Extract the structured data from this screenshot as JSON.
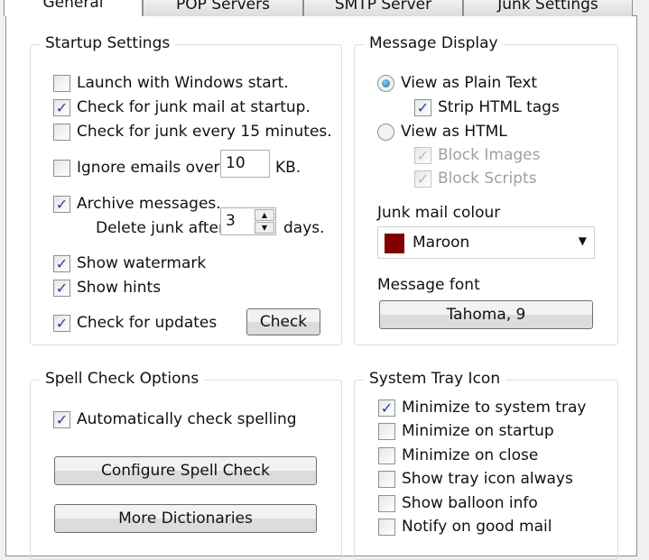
{
  "tabs": [
    "General",
    "POP Servers",
    "SMTP Server",
    "Junk Settings"
  ],
  "startup": {
    "title": "Startup Settings",
    "launch": "Launch with Windows start.",
    "check_startup": "Check for junk mail at startup.",
    "check_every": "Check for junk every 15 minutes.",
    "ignore": "Ignore emails over",
    "ignore_value": "10",
    "ignore_unit": "KB.",
    "archive": "Archive messages.",
    "delete_after": "Delete junk after",
    "delete_value": "3",
    "delete_unit": "days.",
    "watermark": "Show watermark",
    "hints": "Show hints",
    "updates": "Check for updates",
    "check_button": "Check"
  },
  "display": {
    "title": "Message Display",
    "plain": "View as Plain Text",
    "strip": "Strip HTML tags",
    "html": "View as HTML",
    "block_images": "Block Images",
    "block_scripts": "Block Scripts",
    "colour_label": "Junk mail colour",
    "colour_value": "Maroon",
    "colour_hex": "#800000",
    "font_label": "Message font",
    "font_button": "Tahoma, 9"
  },
  "spell": {
    "title": "Spell Check Options",
    "auto": "Automatically check spelling",
    "configure": "Configure Spell Check",
    "dictionaries": "More Dictionaries"
  },
  "tray": {
    "title": "System Tray Icon",
    "items": [
      "Minimize to system tray",
      "Minimize on startup",
      "Minimize on close",
      "Show tray icon always",
      "Show balloon info",
      "Notify on good mail"
    ]
  }
}
